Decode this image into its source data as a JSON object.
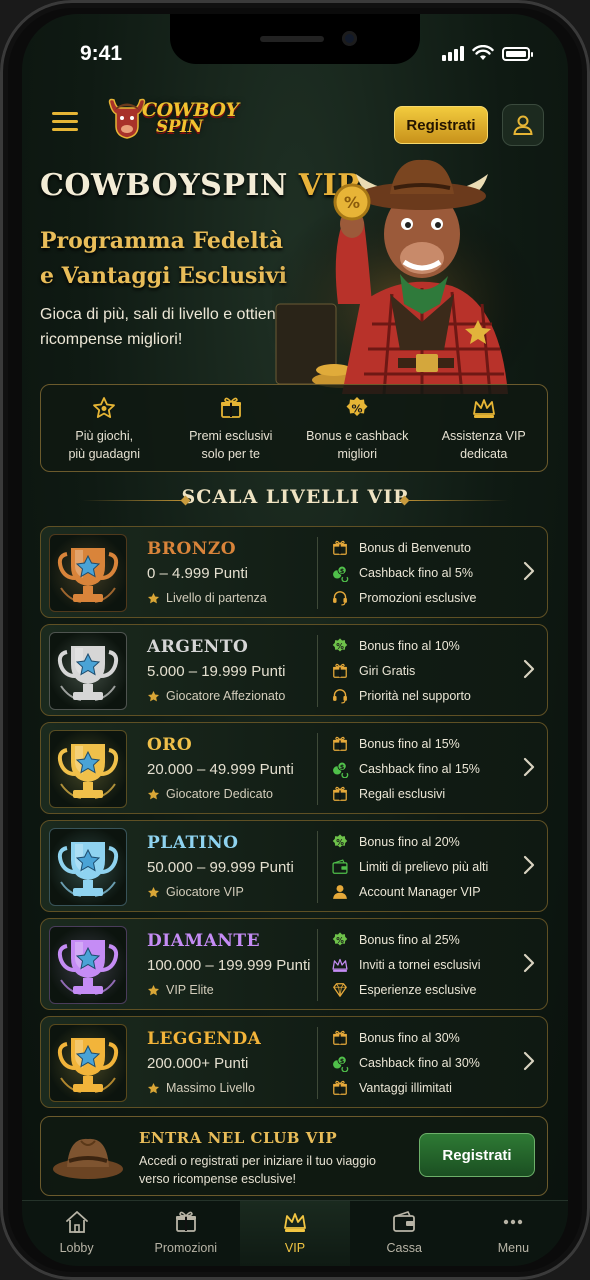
{
  "status_bar": {
    "time": "9:41"
  },
  "header": {
    "logo_line1": "COWBOY",
    "logo_line2": "SPIN",
    "register_label": "Registrati"
  },
  "hero": {
    "title_main": "COWBOYSPIN",
    "title_vip": "VIP",
    "subtitle": "Programma Fedeltà e Vantaggi Esclusivi",
    "description": "Gioca di più, sali di livello e ottieni ricompense migliori!"
  },
  "features": [
    {
      "icon": "star-icon",
      "label": "Più giochi,\npiù guadagni"
    },
    {
      "icon": "gift-icon",
      "label": "Premi esclusivi\nsolo per te"
    },
    {
      "icon": "percent-badge-icon",
      "label": "Bonus e cashback\nmigliori"
    },
    {
      "icon": "crown-icon",
      "label": "Assistenza VIP\ndedicata"
    }
  ],
  "section_title": "SCALA LIVELLI VIP",
  "tiers": [
    {
      "name": "BRONZO",
      "points": "0 – 4.999 Punti",
      "level": "Livello di partenza",
      "color": "#d9843a",
      "perks": [
        {
          "icon": "gift-icon",
          "text": "Bonus di Benvenuto"
        },
        {
          "icon": "coins-icon",
          "text": "Cashback fino al 5%"
        },
        {
          "icon": "headset-icon",
          "text": "Promozioni esclusive"
        }
      ]
    },
    {
      "name": "ARGENTO",
      "points": "5.000 – 19.999 Punti",
      "level": "Giocatore Affezionato",
      "color": "#d6d6d6",
      "perks": [
        {
          "icon": "percent-badge-icon",
          "text": "Bonus fino al 10%"
        },
        {
          "icon": "gift-icon",
          "text": "Giri Gratis"
        },
        {
          "icon": "headset-icon",
          "text": "Priorità nel supporto"
        }
      ]
    },
    {
      "name": "ORO",
      "points": "20.000 – 49.999 Punti",
      "level": "Giocatore Dedicato",
      "color": "#f0c04a",
      "perks": [
        {
          "icon": "gift-icon",
          "text": "Bonus fino al 15%"
        },
        {
          "icon": "coins-icon",
          "text": "Cashback fino al 15%"
        },
        {
          "icon": "gift-icon",
          "text": "Regali esclusivi"
        }
      ]
    },
    {
      "name": "PLATINO",
      "points": "50.000 – 99.999 Punti",
      "level": "Giocatore VIP",
      "color": "#8fd3f0",
      "perks": [
        {
          "icon": "percent-badge-icon",
          "text": "Bonus fino al 20%"
        },
        {
          "icon": "wallet-icon",
          "text": "Limiti di prelievo più alti"
        },
        {
          "icon": "user-icon",
          "text": "Account Manager VIP"
        }
      ]
    },
    {
      "name": "DIAMANTE",
      "points": "100.000 – 199.999 Punti",
      "level": "VIP Elite",
      "color": "#c58cf5",
      "perks": [
        {
          "icon": "percent-badge-icon",
          "text": "Bonus fino al 25%"
        },
        {
          "icon": "crown-icon",
          "text": "Inviti a tornei esclusivi"
        },
        {
          "icon": "diamond-icon",
          "text": "Esperienze esclusive"
        }
      ]
    },
    {
      "name": "LEGGENDA",
      "points": "200.000+ Punti",
      "level": "Massimo Livello",
      "color": "#f2b43a",
      "perks": [
        {
          "icon": "gift-icon",
          "text": "Bonus fino al 30%"
        },
        {
          "icon": "coins-icon",
          "text": "Cashback fino al 30%"
        },
        {
          "icon": "gift-icon",
          "text": "Vantaggi illimitati"
        }
      ]
    }
  ],
  "club": {
    "title": "ENTRA NEL CLUB VIP",
    "description": "Accedi o registrati per iniziare il tuo viaggio verso ricompense esclusive!",
    "button_label": "Registrati"
  },
  "nav": [
    {
      "icon": "home-icon",
      "label": "Lobby",
      "active": false
    },
    {
      "icon": "gift-icon",
      "label": "Promozioni",
      "active": false
    },
    {
      "icon": "crown-icon",
      "label": "VIP",
      "active": true
    },
    {
      "icon": "wallet-icon",
      "label": "Cassa",
      "active": false
    },
    {
      "icon": "more-icon",
      "label": "Menu",
      "active": false
    }
  ],
  "colors": {
    "gold": "#e9bd59",
    "green_bg": "#0f1a13",
    "accent_yellow": "#f2cb3e",
    "button_green": "#2e7a34"
  }
}
